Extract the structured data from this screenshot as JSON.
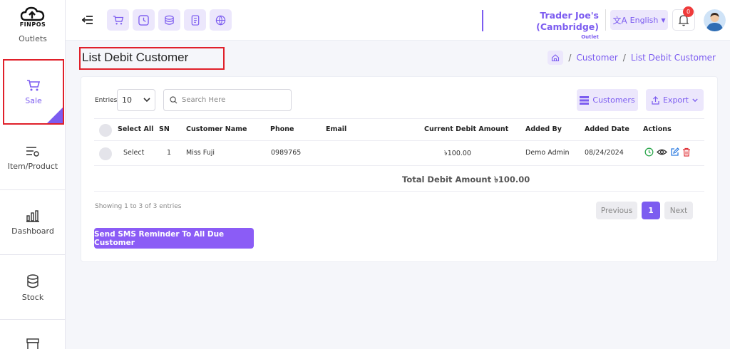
{
  "app": {
    "logo_text": "FINPOS"
  },
  "sidebar": {
    "cut_label": "Outlets",
    "items": [
      {
        "label": "Sale",
        "icon": "cart-icon"
      },
      {
        "label": "Item/Product",
        "icon": "filter-list-icon"
      },
      {
        "label": "Dashboard",
        "icon": "bar-chart-icon"
      },
      {
        "label": "Stock",
        "icon": "database-icon"
      }
    ]
  },
  "header": {
    "store_name": "Trader Joe's (Cambridge)",
    "store_type": "Outlet",
    "language": "English",
    "notification_count": "0",
    "quick_icons": [
      "cart-icon",
      "clock-icon",
      "coins-icon",
      "receipt-icon",
      "globe-icon"
    ]
  },
  "page": {
    "title": "List Debit Customer",
    "breadcrumb": [
      "Customer",
      "List Debit Customer"
    ]
  },
  "toolbar": {
    "entries_label": "Entries",
    "entries_value": "10",
    "search_placeholder": "Search Here",
    "customers_label": "Customers",
    "export_label": "Export"
  },
  "table": {
    "headers": {
      "select_all": "Select All",
      "sn": "SN",
      "customer_name": "Customer Name",
      "phone": "Phone",
      "email": "Email",
      "current_debit": "Current Debit Amount",
      "added_by": "Added By",
      "added_date": "Added Date",
      "actions": "Actions"
    },
    "rows": [
      {
        "select": "Select",
        "sn": "1",
        "customer_name": "Miss Fuji",
        "phone": "0989765",
        "email": "",
        "current_debit": "৳100.00",
        "added_by": "Demo Admin",
        "added_date": "08/24/2024"
      }
    ],
    "total": "Total Debit Amount ৳100.00"
  },
  "pagination": {
    "showing": "Showing 1 to 3 of 3 entries",
    "previous": "Previous",
    "current": "1",
    "next": "Next"
  },
  "sms_button": "Send SMS Reminder To All Due Customer",
  "colors": {
    "accent": "#7c5cf0",
    "accent_light": "#ece7fc",
    "highlight": "#e0202a"
  }
}
